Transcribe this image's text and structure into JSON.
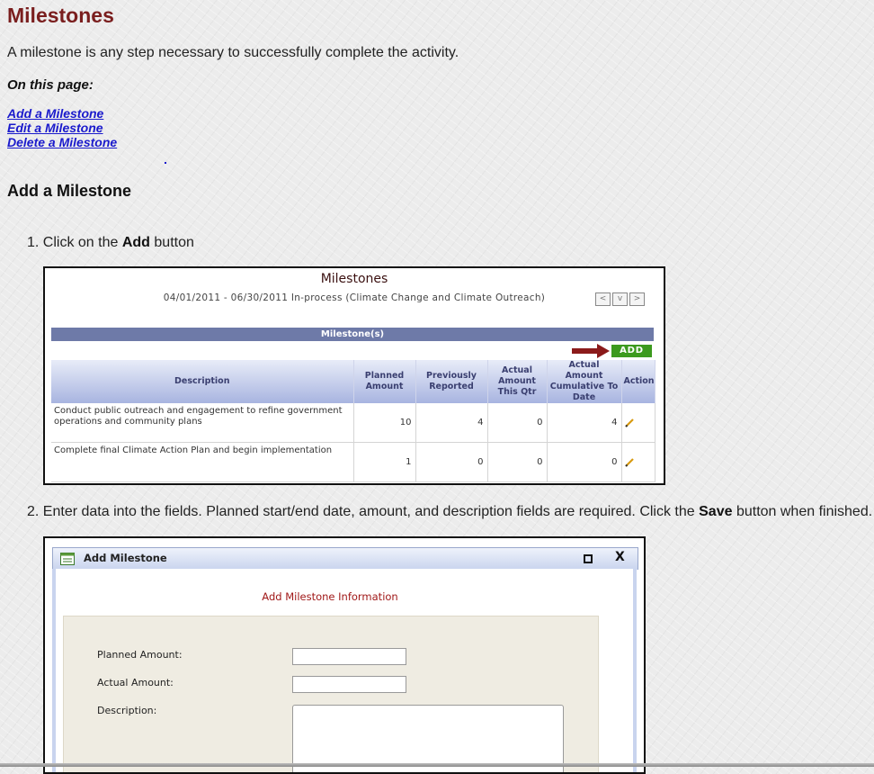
{
  "page": {
    "title": "Milestones",
    "intro": "A milestone is any step necessary to successfully complete the activity.",
    "on_this_page": "On this page:",
    "links": [
      "Add a Milestone",
      "Edit a Milestone",
      "Delete a Milestone"
    ],
    "section_title": "Add a Milestone"
  },
  "steps": {
    "step1": {
      "num": "1.",
      "pre": "Click on the ",
      "bold": "Add",
      "post": " button"
    },
    "step2": {
      "num": "2.",
      "pre": "Enter data into the fields. Planned start/end date, amount, and description fields are required. Click the ",
      "bold": "Save",
      "post": " button when finished."
    }
  },
  "milestones_shot": {
    "title": "Milestones",
    "subtitle": "04/01/2011 - 06/30/2011 In-process (Climate Change and Climate Outreach)",
    "nav": [
      "<",
      "v",
      ">"
    ],
    "bar_label": "Milestone(s)",
    "add_label": "ADD",
    "arrow_color": "#8b1a1a",
    "columns": [
      "Description",
      "Planned Amount",
      "Previously Reported",
      "Actual Amount This Qtr",
      "Actual Amount Cumulative To Date",
      "Action"
    ],
    "rows": [
      {
        "description": "Conduct public outreach and engagement to refine government operations and community plans",
        "planned": "10",
        "previously": "4",
        "actual_qtr": "0",
        "cumulative": "4",
        "action_icon": "pencil-icon"
      },
      {
        "description": "Complete final Climate Action Plan and begin implementation",
        "planned": "1",
        "previously": "0",
        "actual_qtr": "0",
        "cumulative": "0",
        "action_icon": "pencil-icon"
      }
    ]
  },
  "add_dialog": {
    "window_title": "Add Milestone",
    "maximize_icon": "maximize-icon",
    "close_label": "X",
    "heading": "Add Milestone Information",
    "fields": {
      "planned_label": "Planned Amount:",
      "planned_value": "",
      "actual_label": "Actual Amount:",
      "actual_value": "",
      "description_label": "Description:",
      "description_value": ""
    }
  }
}
